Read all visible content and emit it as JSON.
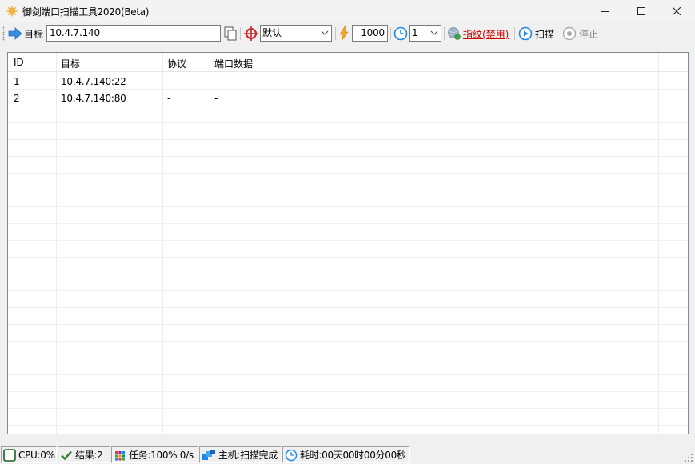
{
  "window": {
    "title": "御剑端口扫描工具2020(Beta)"
  },
  "toolbar": {
    "target_label": "目标",
    "target_value": "10.4.7.140",
    "mode_value": "默认",
    "threads_value": "1000",
    "timeout_value": "1",
    "fingerprint_label": "指纹(禁用)",
    "scan_label": "扫描",
    "stop_label": "停止"
  },
  "table": {
    "columns": [
      "ID",
      "目标",
      "协议",
      "端口数据"
    ],
    "rows": [
      {
        "id": "1",
        "target": "10.4.7.140:22",
        "protocol": "-",
        "data": "-"
      },
      {
        "id": "2",
        "target": "10.4.7.140:80",
        "protocol": "-",
        "data": "-"
      }
    ]
  },
  "status": {
    "cpu": "CPU:0%",
    "results": "结果:2",
    "tasks": "任务:100% 0/s",
    "host": "主机:扫描完成",
    "elapsed": "耗时:00天00时00分00秒"
  },
  "colors": {
    "accent_blue": "#1e88e5",
    "link_red": "#d40000",
    "grid_border": "#828790"
  }
}
